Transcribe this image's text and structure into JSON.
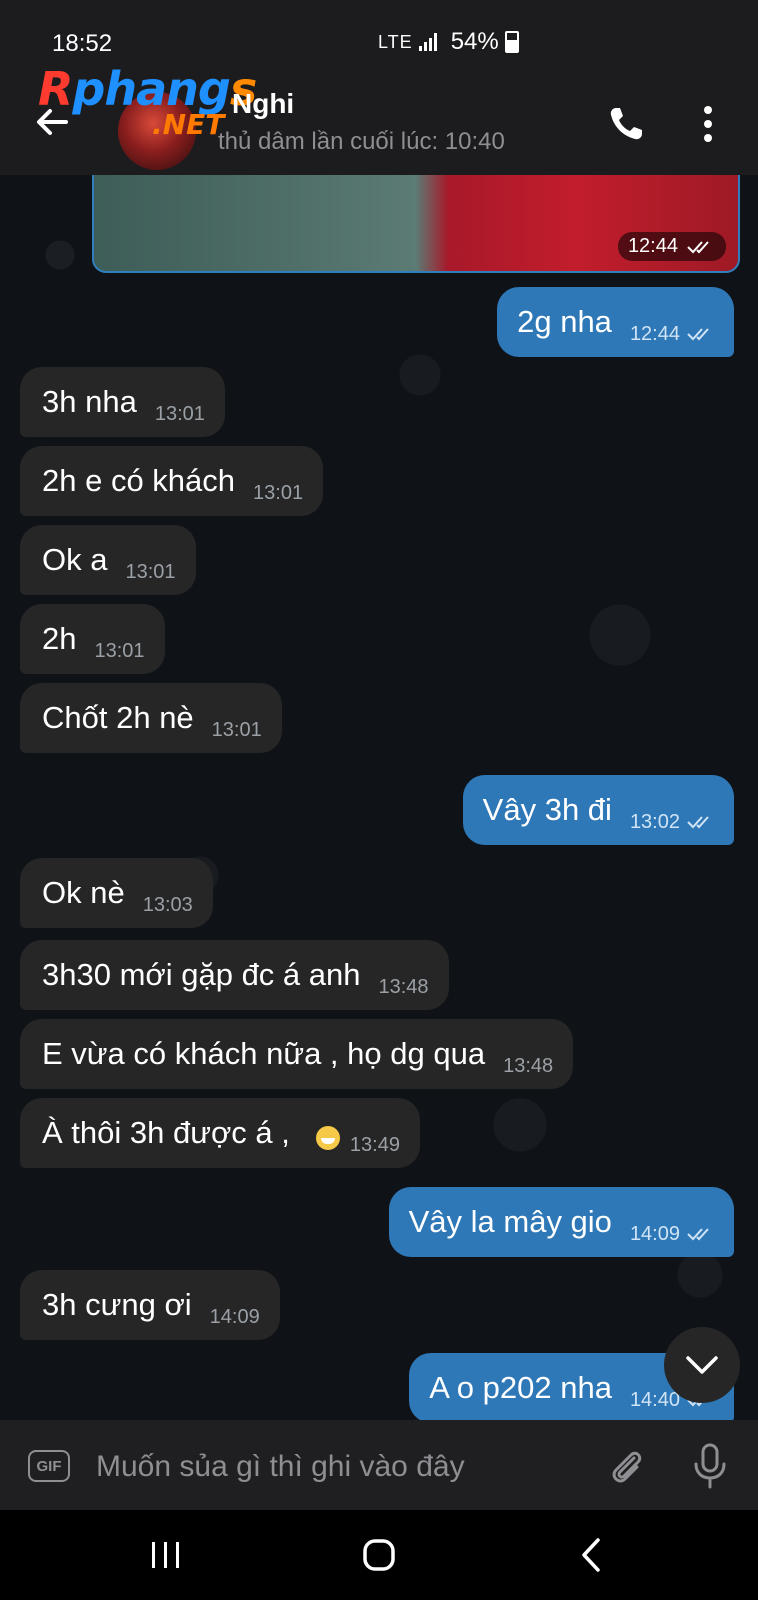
{
  "status_bar": {
    "time": "18:52",
    "network": "LTE",
    "battery": "54%"
  },
  "watermark": {
    "brand": "Rphangs",
    "suffix": ".NET"
  },
  "header": {
    "contact_name": "Nghi",
    "last_seen": "thủ dâm lần cuối lúc: 10:40"
  },
  "media": {
    "time": "12:44"
  },
  "messages": [
    {
      "dir": "out",
      "text": "2g nha",
      "time": "12:44"
    },
    {
      "dir": "in",
      "text": "3h nha",
      "time": "13:01"
    },
    {
      "dir": "in",
      "text": "2h e có khách",
      "time": "13:01"
    },
    {
      "dir": "in",
      "text": "Ok a",
      "time": "13:01"
    },
    {
      "dir": "in",
      "text": "2h",
      "time": "13:01"
    },
    {
      "dir": "in",
      "text": "Chốt 2h nè",
      "time": "13:01"
    },
    {
      "dir": "out",
      "text": "Vây 3h đi",
      "time": "13:02"
    },
    {
      "dir": "in",
      "text": "Ok nè",
      "time": "13:03"
    },
    {
      "dir": "in",
      "text": "3h30 mới gặp đc á anh",
      "time": "13:48"
    },
    {
      "dir": "in",
      "text": "E vừa có khách nữa , họ dg qua",
      "time": "13:48"
    },
    {
      "dir": "in",
      "text": "À thôi 3h được á ,",
      "time": "13:49",
      "emoji": "grinning-face"
    },
    {
      "dir": "out",
      "text": "Vây la mây gio",
      "time": "14:09"
    },
    {
      "dir": "in",
      "text": "3h cưng ơi",
      "time": "14:09"
    },
    {
      "dir": "out",
      "text": "A o p202 nha",
      "time": "14:40"
    }
  ],
  "input": {
    "gif_label": "GIF",
    "placeholder": "Muốn sủa gì thì ghi vào đây"
  },
  "colors": {
    "outgoing_bubble": "#2f78b7",
    "incoming_bubble": "#262626",
    "background": "#0f1318"
  }
}
